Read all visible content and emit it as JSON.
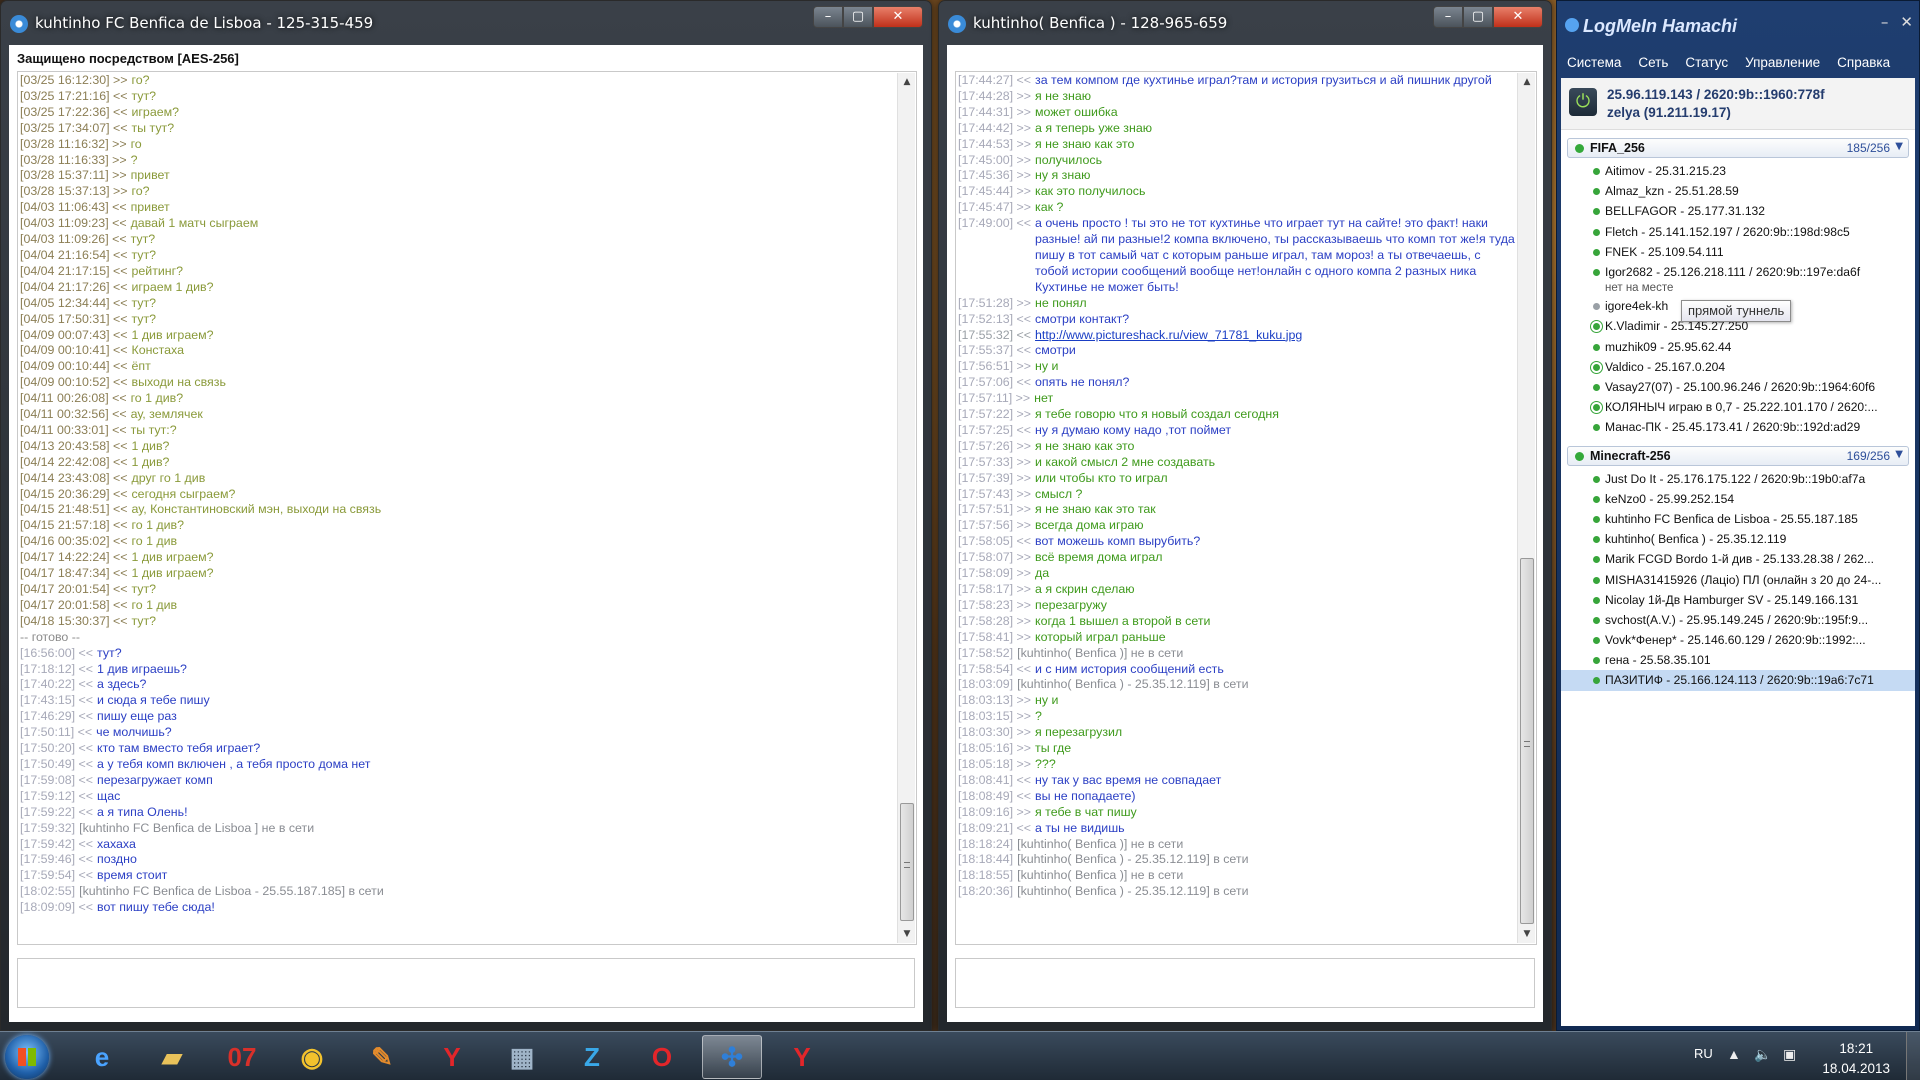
{
  "win1": {
    "title": "kuhtinho FC Benfica de Lisboa  - 125-315-459",
    "security": "Защищено посредством [AES-256]",
    "messages": [
      {
        "t": "[03/25 16:12:30] >>",
        "b": "го?",
        "k": "n"
      },
      {
        "t": "[03/25 17:21:16] <<",
        "b": "тут?",
        "k": "n"
      },
      {
        "t": "[03/25 17:22:36] <<",
        "b": "играем?",
        "k": "n"
      },
      {
        "t": "[03/25 17:34:07] <<",
        "b": "ты тут?",
        "k": "n"
      },
      {
        "t": "[03/28 11:16:32] >>",
        "b": "го",
        "k": "n"
      },
      {
        "t": "[03/28 11:16:33] >>",
        "b": " ?",
        "k": "n"
      },
      {
        "t": "[03/28 15:37:11] >>",
        "b": "привет",
        "k": "n"
      },
      {
        "t": "[03/28 15:37:13] >>",
        "b": "го?",
        "k": "n"
      },
      {
        "t": "[04/03 11:06:43] <<",
        "b": "привет",
        "k": "n"
      },
      {
        "t": "[04/03 11:09:23] <<",
        "b": "давай 1 матч сыграем",
        "k": "n"
      },
      {
        "t": "[04/03 11:09:26] <<",
        "b": "тут?",
        "k": "n"
      },
      {
        "t": "[04/04 21:16:54] <<",
        "b": "тут?",
        "k": "n"
      },
      {
        "t": "[04/04 21:17:15] <<",
        "b": "рейтинг?",
        "k": "n"
      },
      {
        "t": "[04/04 21:17:26] <<",
        "b": "играем 1 див?",
        "k": "n"
      },
      {
        "t": "[04/05 12:34:44] <<",
        "b": "тут?",
        "k": "n"
      },
      {
        "t": "[04/05 17:50:31] <<",
        "b": "тут?",
        "k": "n"
      },
      {
        "t": "[04/09 00:07:43] <<",
        "b": "1 див играем?",
        "k": "n"
      },
      {
        "t": "[04/09 00:10:41] <<",
        "b": "Констаха",
        "k": "n"
      },
      {
        "t": "[04/09 00:10:44] <<",
        "b": "ёпт",
        "k": "n"
      },
      {
        "t": "[04/09 00:10:52] <<",
        "b": "выходи на связь",
        "k": "n"
      },
      {
        "t": "[04/11 00:26:08] <<",
        "b": "го 1 див?",
        "k": "n"
      },
      {
        "t": "[04/11 00:32:56] <<",
        "b": "ау, землячек",
        "k": "n"
      },
      {
        "t": "[04/11 00:33:01] <<",
        "b": "ты тут:?",
        "k": "n"
      },
      {
        "t": "[04/13 20:43:58] <<",
        "b": "1 див?",
        "k": "n"
      },
      {
        "t": "[04/14 22:42:08] <<",
        "b": "1 див?",
        "k": "n"
      },
      {
        "t": "[04/14 23:43:08] <<",
        "b": "друг го 1 див",
        "k": "n"
      },
      {
        "t": "[04/15 20:36:29] <<",
        "b": "сегодня сыграем?",
        "k": "n"
      },
      {
        "t": "[04/15 21:48:51] <<",
        "b": "ау, Константиновский мэн, выходи на связь",
        "k": "n"
      },
      {
        "t": "[04/15 21:57:18] <<",
        "b": "го 1 див?",
        "k": "n"
      },
      {
        "t": "[04/16 00:35:02] <<",
        "b": "го 1 див",
        "k": "n"
      },
      {
        "t": "[04/17 14:22:24] <<",
        "b": "1 див играем?",
        "k": "n"
      },
      {
        "t": "[04/17 18:47:34] <<",
        "b": "1 див играем?",
        "k": "n"
      },
      {
        "t": "[04/17 20:01:54] <<",
        "b": "тут?",
        "k": "n"
      },
      {
        "t": "[04/17 20:01:58] <<",
        "b": "го 1 див",
        "k": "n"
      },
      {
        "t": "[04/18 15:30:37] <<",
        "b": "тут?",
        "k": "n"
      },
      {
        "t": "-- готово --",
        "b": "",
        "k": "sp"
      },
      {
        "t": "[16:56:00] <<",
        "b": "   тут?",
        "k": "o"
      },
      {
        "t": "[17:18:12] <<",
        "b": "   1 див играешь?",
        "k": "o"
      },
      {
        "t": "[17:40:22] <<",
        "b": "   а здесь?",
        "k": "o"
      },
      {
        "t": "[17:43:15] <<",
        "b": "   и сюда я тебе пишу",
        "k": "o"
      },
      {
        "t": "[17:46:29] <<",
        "b": "   пишу еще раз",
        "k": "o"
      },
      {
        "t": "[17:50:11] <<",
        "b": "   че молчишь?",
        "k": "o"
      },
      {
        "t": "[17:50:20] <<",
        "b": "   кто там вместо тебя играет?",
        "k": "o"
      },
      {
        "t": "[17:50:49] <<",
        "b": "   а у тебя комп включен , а тебя просто дома нет",
        "k": "o"
      },
      {
        "t": "[17:59:08] <<",
        "b": "   перезагружает комп",
        "k": "o"
      },
      {
        "t": "[17:59:12] <<",
        "b": "   щас",
        "k": "o"
      },
      {
        "t": "[17:59:22] <<",
        "b": "   а я типа Олень!",
        "k": "o"
      },
      {
        "t": "[17:59:32]",
        "b": "       [kuhtinho FC Benfica de Lisboa ] не в сети",
        "k": "s"
      },
      {
        "t": "[17:59:42] <<",
        "b": "   хахаха",
        "k": "o"
      },
      {
        "t": "[17:59:46] <<",
        "b": "   поздно",
        "k": "o"
      },
      {
        "t": "[17:59:54] <<",
        "b": "   время стоит",
        "k": "o"
      },
      {
        "t": "[18:02:55]",
        "b": "       [kuhtinho FC Benfica de Lisboa  - 25.55.187.185] в сети",
        "k": "s"
      },
      {
        "t": "[18:09:09] <<",
        "b": "   вот пишу тебе сюда!",
        "k": "o"
      }
    ]
  },
  "win2": {
    "title": "kuhtinho( Benfica ) - 128-965-659",
    "messages": [
      {
        "t": "[17:44:27] <<",
        "b": "   за тем компом где кухтинье играл?там и  история грузиться и ай пишник другой",
        "k": "o",
        "w": true
      },
      {
        "t": "[17:44:28] >>",
        "b": "   я не знаю",
        "k": "i"
      },
      {
        "t": "[17:44:31] >>",
        "b": "   может ошибка",
        "k": "i"
      },
      {
        "t": "[17:44:42] >>",
        "b": "   а я теперь уже знаю",
        "k": "i"
      },
      {
        "t": "[17:44:53] >>",
        "b": "   я не знаю как это",
        "k": "i"
      },
      {
        "t": "[17:45:00] >>",
        "b": "   получилось",
        "k": "i"
      },
      {
        "t": "[17:45:36] >>",
        "b": "   ну я знаю",
        "k": "i"
      },
      {
        "t": "[17:45:44] >>",
        "b": "   как это получилось",
        "k": "i"
      },
      {
        "t": "[17:45:47] >>",
        "b": "   как ?",
        "k": "i"
      },
      {
        "t": "[17:49:00] <<",
        "b": "   а очень просто ! ты это не тот кухтинье что играет тут на сайте! это факт! наки разные! ай пи разные!2 компа включено, ты рассказываешь что комп тот же!я туда пишу в тот самый чат  с которым раньше играл, там мороз! а ты отвечаешь, с тобой истории сообщений вообще нет!онлайн с одного компа 2 разных ника Кухтинье не может быть!",
        "k": "o",
        "w": true
      },
      {
        "t": "[17:51:28] >>",
        "b": "   не понял",
        "k": "i"
      },
      {
        "t": "[17:52:13] <<",
        "b": "   смотри контакт?",
        "k": "o"
      },
      {
        "t": "[17:55:32] <<",
        "b": "   http://www.pictureshack.ru/view_71781_kuku.jpg",
        "k": "l"
      },
      {
        "t": "[17:55:37] <<",
        "b": "   смотри",
        "k": "o"
      },
      {
        "t": "[17:56:51] >>",
        "b": "   ну и",
        "k": "i"
      },
      {
        "t": "[17:57:06] <<",
        "b": "   опять не понял?",
        "k": "o"
      },
      {
        "t": "[17:57:11] >>",
        "b": "   нет",
        "k": "i"
      },
      {
        "t": "[17:57:22] >>",
        "b": "   я тебе говорю что я новый создал сегодня",
        "k": "i"
      },
      {
        "t": "[17:57:25] <<",
        "b": "   ну я думаю кому надо ,тот поймет",
        "k": "o"
      },
      {
        "t": "[17:57:26] >>",
        "b": "   я не знаю как это",
        "k": "i"
      },
      {
        "t": "[17:57:33] >>",
        "b": "   и какой смысл 2 мне создавать",
        "k": "i"
      },
      {
        "t": "[17:57:39] >>",
        "b": "   или чтобы кто то играл",
        "k": "i"
      },
      {
        "t": "[17:57:43] >>",
        "b": "   смысл ?",
        "k": "i"
      },
      {
        "t": "[17:57:51] >>",
        "b": "   я не знаю как это так",
        "k": "i"
      },
      {
        "t": "[17:57:56] >>",
        "b": "   всегда дома играю",
        "k": "i"
      },
      {
        "t": "[17:58:05] <<",
        "b": "   вот можешь комп вырубить?",
        "k": "o"
      },
      {
        "t": "[17:58:07] >>",
        "b": "   всё время дома играл",
        "k": "i"
      },
      {
        "t": "[17:58:09] >>",
        "b": "   да",
        "k": "i"
      },
      {
        "t": "[17:58:17] >>",
        "b": "   а я скрин сделаю",
        "k": "i"
      },
      {
        "t": "[17:58:23] >>",
        "b": "   перезагружу",
        "k": "i"
      },
      {
        "t": "[17:58:28] >>",
        "b": "   когда 1 вышел а второй в сети",
        "k": "i"
      },
      {
        "t": "[17:58:41] >>",
        "b": "   который играл раньше",
        "k": "i"
      },
      {
        "t": "[17:58:52]",
        "b": "       [kuhtinho( Benfica )] не в сети",
        "k": "s"
      },
      {
        "t": "[17:58:54] <<",
        "b": "   и с ним история сообщений есть",
        "k": "o"
      },
      {
        "t": "[18:03:09]",
        "b": "       [kuhtinho( Benfica ) - 25.35.12.119] в сети",
        "k": "s"
      },
      {
        "t": "[18:03:13] >>",
        "b": "   ну и",
        "k": "i"
      },
      {
        "t": "[18:03:15] >>",
        "b": "    ?",
        "k": "i"
      },
      {
        "t": "[18:03:30] >>",
        "b": "   я перезагрузил",
        "k": "i"
      },
      {
        "t": "[18:05:16] >>",
        "b": "   ты где",
        "k": "i"
      },
      {
        "t": "[18:05:18] >>",
        "b": "    ???",
        "k": "i"
      },
      {
        "t": "[18:08:41] <<",
        "b": "   ну так у вас время не совпадает",
        "k": "o"
      },
      {
        "t": "[18:08:49] <<",
        "b": "   вы не попадаете)",
        "k": "o"
      },
      {
        "t": "[18:09:16] >>",
        "b": "   я тебе в чат пишу",
        "k": "i"
      },
      {
        "t": "[18:09:21] <<",
        "b": "   а ты не видишь",
        "k": "o"
      },
      {
        "t": "[18:18:24]",
        "b": "       [kuhtinho( Benfica )] не в сети",
        "k": "s"
      },
      {
        "t": "[18:18:44]",
        "b": "       [kuhtinho( Benfica ) - 25.35.12.119] в сети",
        "k": "s"
      },
      {
        "t": "[18:18:55]",
        "b": "       [kuhtinho( Benfica )] не в сети",
        "k": "s"
      },
      {
        "t": "[18:20:36]",
        "b": "       [kuhtinho( Benfica ) - 25.35.12.119] в сети",
        "k": "s"
      }
    ]
  },
  "hamachi": {
    "title": "LogMeIn Hamachi",
    "menu": [
      "Система",
      "Сеть",
      "Статус",
      "Управление",
      "Справка"
    ],
    "my_ip": "25.96.119.143 / 2620:9b::1960:778f",
    "my_name": "zelya (91.211.19.17)",
    "tooltip": "прямой туннель",
    "groups": [
      {
        "name": "FIFA_256",
        "count": "185/256",
        "peers": [
          {
            "n": "Aitimov - 25.31.215.23"
          },
          {
            "n": "Almaz_kzn  - 25.51.28.59"
          },
          {
            "n": "BELLFAGOR - 25.177.31.132"
          },
          {
            "n": "Fletch - 25.141.152.197 / 2620:9b::198d:98c5"
          },
          {
            "n": "FNEK - 25.109.54.111"
          },
          {
            "n": "Igor2682  - 25.126.218.111 / 2620:9b::197e:da6f",
            "note": "нет на месте"
          },
          {
            "n": "igore4ek-kh",
            "c": "gray"
          },
          {
            "n": "K.Vladimir  - 25.145.27.250",
            "c": "ring"
          },
          {
            "n": "muzhik09 - 25.95.62.44"
          },
          {
            "n": "Valdico - 25.167.0.204",
            "c": "ring"
          },
          {
            "n": "Vasay27(07) - 25.100.96.246 / 2620:9b::1964:60f6"
          },
          {
            "n": "КОЛЯНЫЧ играю в 0,7 - 25.222.101.170 / 2620:...",
            "c": "ring"
          },
          {
            "n": "Манас-ПК - 25.45.173.41 / 2620:9b::192d:ad29"
          }
        ]
      },
      {
        "name": "Minecraft-256",
        "count": "169/256",
        "peers": [
          {
            "n": "Just Do It - 25.176.175.122 / 2620:9b::19b0:af7a"
          },
          {
            "n": "keNzo0 - 25.99.252.154"
          },
          {
            "n": "kuhtinho FC Benfica de Lisboa  - 25.55.187.185"
          },
          {
            "n": "kuhtinho( Benfica ) - 25.35.12.119"
          },
          {
            "n": "Marik   FCGD Bordo 1-й див - 25.133.28.38 / 262..."
          },
          {
            "n": "MISHA31415926 (Лацio) ПЛ (онлайн з 20 до 24-..."
          },
          {
            "n": "Nicolay 1й-Дв Hamburger SV - 25.149.166.131"
          },
          {
            "n": "svchost(A.V.) - 25.95.149.245 / 2620:9b::195f:9..."
          },
          {
            "n": "Vovk*Фенер* - 25.146.60.129 / 2620:9b::1992:..."
          },
          {
            "n": "гена - 25.58.35.101"
          },
          {
            "n": "ПАЗИТИФ - 25.166.124.113 / 2620:9b::19a6:7c71",
            "sel": true
          }
        ]
      }
    ]
  },
  "taskbar": {
    "apps": [
      {
        "name": "ie-icon",
        "glyph": "e",
        "color": "#4aa3ff"
      },
      {
        "name": "explorer-folder-icon",
        "glyph": "▰",
        "color": "#e9c25a"
      },
      {
        "name": "app-07-icon",
        "glyph": "07",
        "color": "#d8302a"
      },
      {
        "name": "chrome-icon",
        "glyph": "◉",
        "color": "#f2c22d"
      },
      {
        "name": "paint-icon",
        "glyph": "✎",
        "color": "#e38b2c"
      },
      {
        "name": "yandex-icon",
        "glyph": "Y",
        "color": "#e3262a"
      },
      {
        "name": "network-app-icon",
        "glyph": "▦",
        "color": "#9fb4c8"
      },
      {
        "name": "z-app-icon",
        "glyph": "Z",
        "color": "#39a8e8"
      },
      {
        "name": "opera-icon",
        "glyph": "O",
        "color": "#e3262a"
      },
      {
        "name": "hamachi-taskbar-icon",
        "glyph": "✣",
        "color": "#2f7fd8"
      },
      {
        "name": "yandex-browser-icon",
        "glyph": "Y",
        "color": "#e3262a"
      }
    ],
    "lang": "RU",
    "time": "18:21",
    "date": "18.04.2013"
  }
}
